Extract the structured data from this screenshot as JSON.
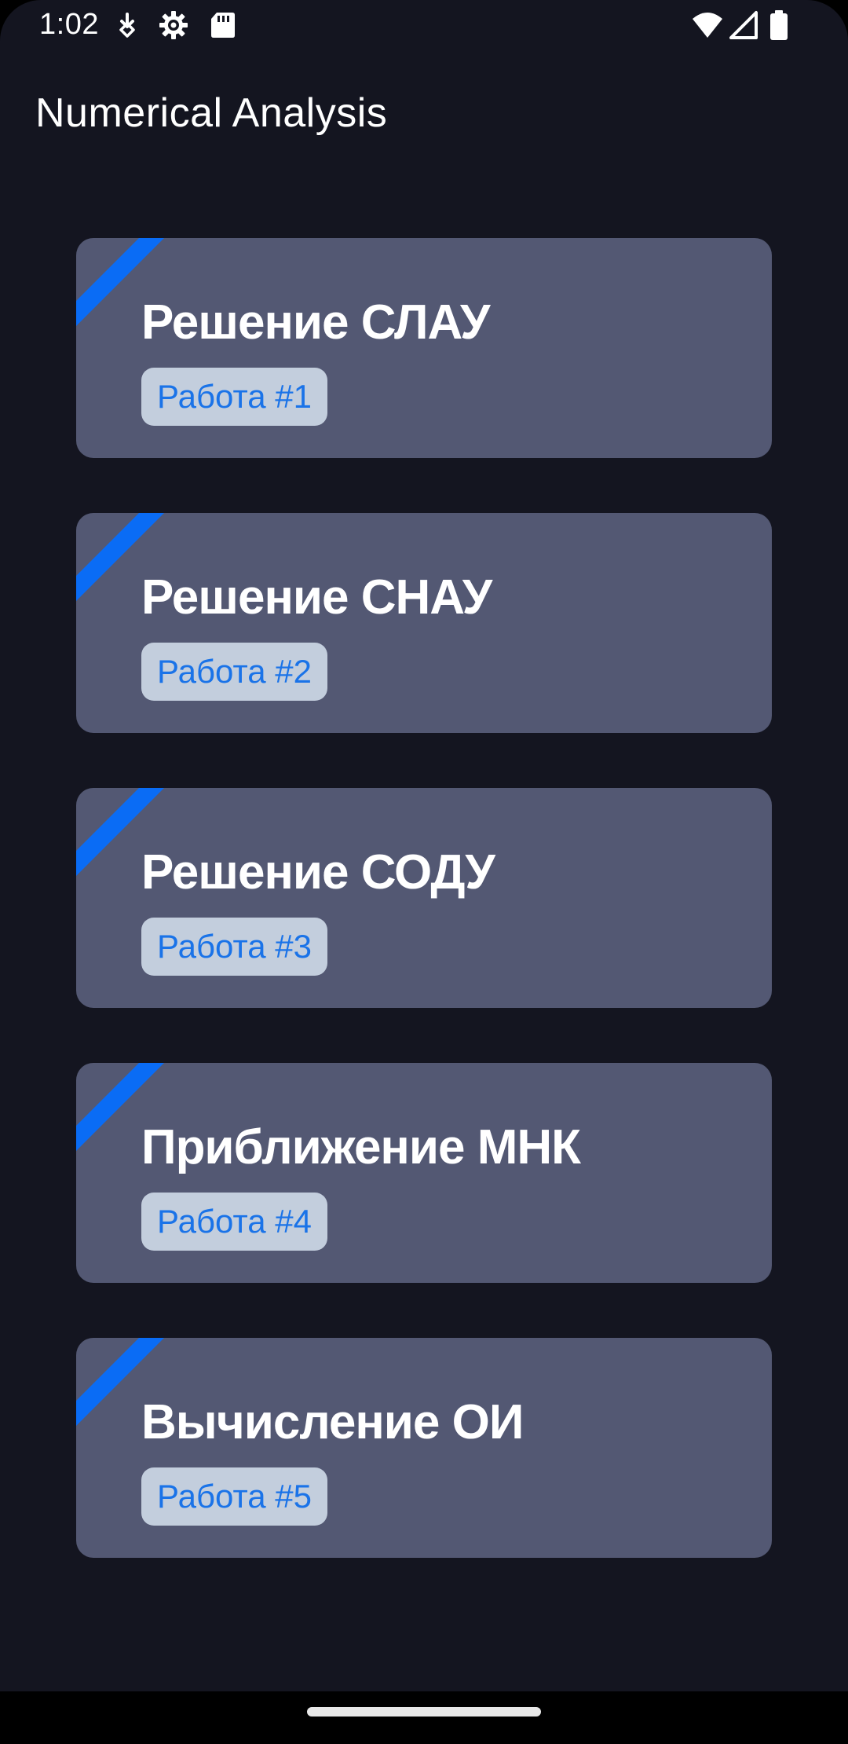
{
  "status_bar": {
    "time": "1:02",
    "icons_left": [
      "download-icon",
      "settings-icon",
      "sd-card-icon"
    ],
    "icons_right": [
      "wifi-icon",
      "cellular-signal-icon",
      "battery-icon"
    ]
  },
  "app_bar": {
    "title": "Numerical Analysis"
  },
  "cards": [
    {
      "title": "Решение СЛАУ",
      "badge": "Работа #1"
    },
    {
      "title": "Решение СНАУ",
      "badge": "Работа #2"
    },
    {
      "title": "Решение СОДУ",
      "badge": "Работа #3"
    },
    {
      "title": "Приближение МНК",
      "badge": "Работа #4"
    },
    {
      "title": "Вычисление ОИ",
      "badge": "Работа #5"
    }
  ],
  "colors": {
    "background": "#141520",
    "card": "#535873",
    "accent_stripe": "#0a6cf5",
    "badge_background": "#c3cedd",
    "badge_text": "#1a73e8"
  }
}
